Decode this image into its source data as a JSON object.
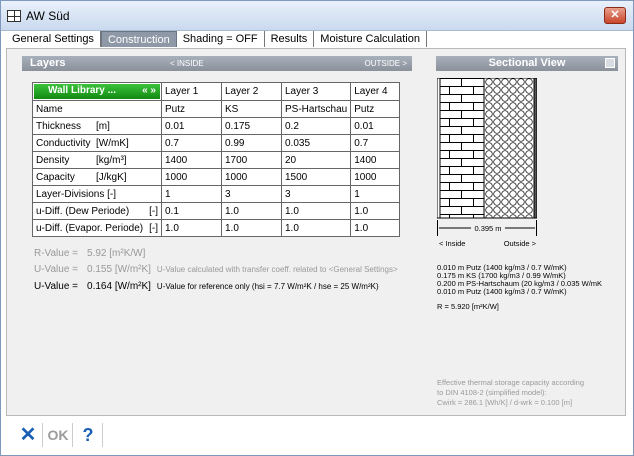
{
  "window": {
    "title": "AW Süd",
    "close_glyph": "✕"
  },
  "tabs": [
    {
      "label": "General Settings",
      "active": false
    },
    {
      "label": "Construction",
      "active": true
    },
    {
      "label": "Shading = OFF",
      "active": false
    },
    {
      "label": "Results",
      "active": false
    },
    {
      "label": "Moisture Calculation",
      "active": false
    }
  ],
  "layers": {
    "title": "Layers",
    "inside_label": "< INSIDE",
    "outside_label": "OUTSIDE >",
    "wall_library_label": "Wall Library ...",
    "wall_library_arrows": "« »",
    "column_headers": [
      "Layer 1",
      "Layer 2",
      "Layer 3",
      "Layer 4"
    ],
    "rows": [
      {
        "label": "Name",
        "unit": "",
        "bracket": "",
        "values": [
          "Putz",
          "KS",
          "PS-Hartschau",
          "Putz"
        ]
      },
      {
        "label": "Thickness",
        "unit": "[m]",
        "bracket": "",
        "values": [
          "0.01",
          "0.175",
          "0.2",
          "0.01"
        ]
      },
      {
        "label": "Conductivity",
        "unit": "[W/mK]",
        "bracket": "",
        "values": [
          "0.7",
          "0.99",
          "0.035",
          "0.7"
        ]
      },
      {
        "label": "Density",
        "unit": "[kg/m³]",
        "bracket": "",
        "values": [
          "1400",
          "1700",
          "20",
          "1400"
        ]
      },
      {
        "label": "Capacity",
        "unit": "[J/kgK]",
        "bracket": "",
        "values": [
          "1000",
          "1000",
          "1500",
          "1000"
        ]
      },
      {
        "label": "Layer-Divisions [-]",
        "unit": "",
        "bracket": "",
        "values": [
          "1",
          "3",
          "3",
          "1"
        ]
      },
      {
        "label": "u-Diff. (Dew Periode)",
        "unit": "",
        "bracket": "[-]",
        "values": [
          "0.1",
          "1.0",
          "1.0",
          "1.0"
        ]
      },
      {
        "label": "u-Diff. (Evapor. Periode)",
        "unit": "",
        "bracket": "[-]",
        "values": [
          "1.0",
          "1.0",
          "1.0",
          "1.0"
        ]
      }
    ]
  },
  "results": {
    "r_value": {
      "label": "R-Value =",
      "value": "5.92 [m²K/W]"
    },
    "u_value_calc": {
      "label": "U-Value =",
      "value": "0.155 [W/m²K]",
      "note": "U-Value calculated with transfer coeff. related to <General Settings>"
    },
    "u_value_ref": {
      "label": "U-Value =",
      "value": "0.164 [W/m²K]",
      "note": "U-Value for reference only  (hsi = 7.7 W/m²K / hse = 25 W/m²K)"
    }
  },
  "sectional_view": {
    "title": "Sectional View",
    "total_thickness": "0.395 m",
    "inside_label": "< Inside",
    "outside_label": "Outside >",
    "layer_lines": [
      "0.010 m Putz (1400 kg/m3 / 0.7 W/mK)",
      "0.175 m KS (1700 kg/m3 / 0.99 W/mK)",
      "0.200 m PS-Hartschaum (20 kg/m3 / 0.035 W/mK",
      "0.010 m Putz (1400 kg/m3 / 0.7 W/mK)"
    ],
    "r_line": "R = 5.920 [m²K/W]",
    "storage_lines": [
      "Effective thermal storage capacity according",
      "to DIN 4108-2 (simplified model):",
      "Cwirk = 286.1 [Wh/K] / d-wrk = 0.100 [m]"
    ]
  },
  "footer": {
    "cancel_glyph": "✕",
    "ok_label": "OK",
    "help_glyph": "?"
  },
  "colors": {
    "accent_green": "#2aa52a",
    "header_gray": "#8f98a6",
    "link_blue": "#1a5fb4"
  }
}
